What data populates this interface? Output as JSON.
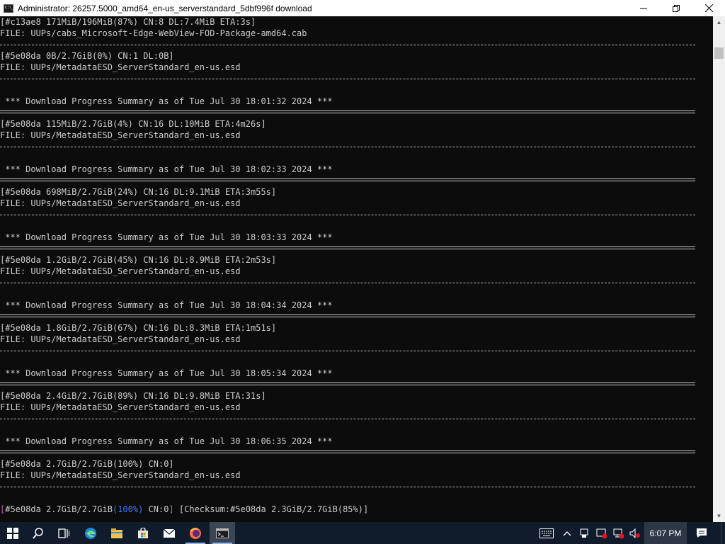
{
  "window": {
    "title": "Administrator:  26257.5000_amd64_en-us_serverstandard_5dbf996f download",
    "minimize_glyph": "—",
    "maximize_glyph": "❐",
    "close_glyph": "✕",
    "icon": "cmd-icon"
  },
  "console": {
    "lines": [
      "[#c13ae8 171MiB/196MiB(87%) CN:8 DL:7.4MiB ETA:3s]",
      "FILE: UUPs/cabs_Microsoft-Edge-WebView-FOD-Package-amd64.cab",
      "[#5e08da 0B/2.7GiB(0%) CN:1 DL:0B]",
      "FILE: UUPs/MetadataESD_ServerStandard_en-us.esd",
      " *** Download Progress Summary as of Tue Jul 30 18:01:32 2024 ***",
      "[#5e08da 115MiB/2.7GiB(4%) CN:16 DL:10MiB ETA:4m26s]",
      "FILE: UUPs/MetadataESD_ServerStandard_en-us.esd",
      " *** Download Progress Summary as of Tue Jul 30 18:02:33 2024 ***",
      "[#5e08da 698MiB/2.7GiB(24%) CN:16 DL:9.1MiB ETA:3m55s]",
      "FILE: UUPs/MetadataESD_ServerStandard_en-us.esd",
      " *** Download Progress Summary as of Tue Jul 30 18:03:33 2024 ***",
      "[#5e08da 1.2GiB/2.7GiB(45%) CN:16 DL:8.9MiB ETA:2m53s]",
      "FILE: UUPs/MetadataESD_ServerStandard_en-us.esd",
      " *** Download Progress Summary as of Tue Jul 30 18:04:34 2024 ***",
      "[#5e08da 1.8GiB/2.7GiB(67%) CN:16 DL:8.3MiB ETA:1m51s]",
      "FILE: UUPs/MetadataESD_ServerStandard_en-us.esd",
      " *** Download Progress Summary as of Tue Jul 30 18:05:34 2024 ***",
      "[#5e08da 2.4GiB/2.7GiB(89%) CN:16 DL:9.8MiB ETA:31s]",
      "FILE: UUPs/MetadataESD_ServerStandard_en-us.esd",
      " *** Download Progress Summary as of Tue Jul 30 18:06:35 2024 ***",
      "[#5e08da 2.7GiB/2.7GiB(100%) CN:0]",
      "FILE: UUPs/MetadataESD_ServerStandard_en-us.esd"
    ],
    "status_line": {
      "open_bracket": "[",
      "prefix": "#5e08da 2.7GiB/2.7GiB",
      "percent": "(100%)",
      "connections": " CN:0",
      "close_bracket": "]",
      "checksum": " [Checksum:#5e08da 2.3GiB/2.7GiB(85%)]"
    },
    "colors": {
      "background": "#0c0c0c",
      "text": "#cccccc",
      "percent": "#3b78ff",
      "bracket": "#b45ab4"
    }
  },
  "scrollbar": {
    "up_glyph": "▲",
    "down_glyph": "▼"
  },
  "taskbar": {
    "pinned": [
      {
        "icon": "windows-start-icon"
      },
      {
        "icon": "search-icon"
      },
      {
        "icon": "task-view-icon"
      },
      {
        "icon": "edge-icon"
      },
      {
        "icon": "file-explorer-icon"
      },
      {
        "icon": "store-icon"
      },
      {
        "icon": "mail-icon"
      },
      {
        "icon": "firefox-icon"
      },
      {
        "icon": "cmd-icon"
      }
    ],
    "tray_icons": [
      "touch-keyboard-icon",
      "chevron-up-icon",
      "usb-icon",
      "security-icon",
      "network-icon",
      "volume-muted-icon"
    ],
    "clock": "6:07 PM",
    "notification_icon": "action-center-icon"
  }
}
